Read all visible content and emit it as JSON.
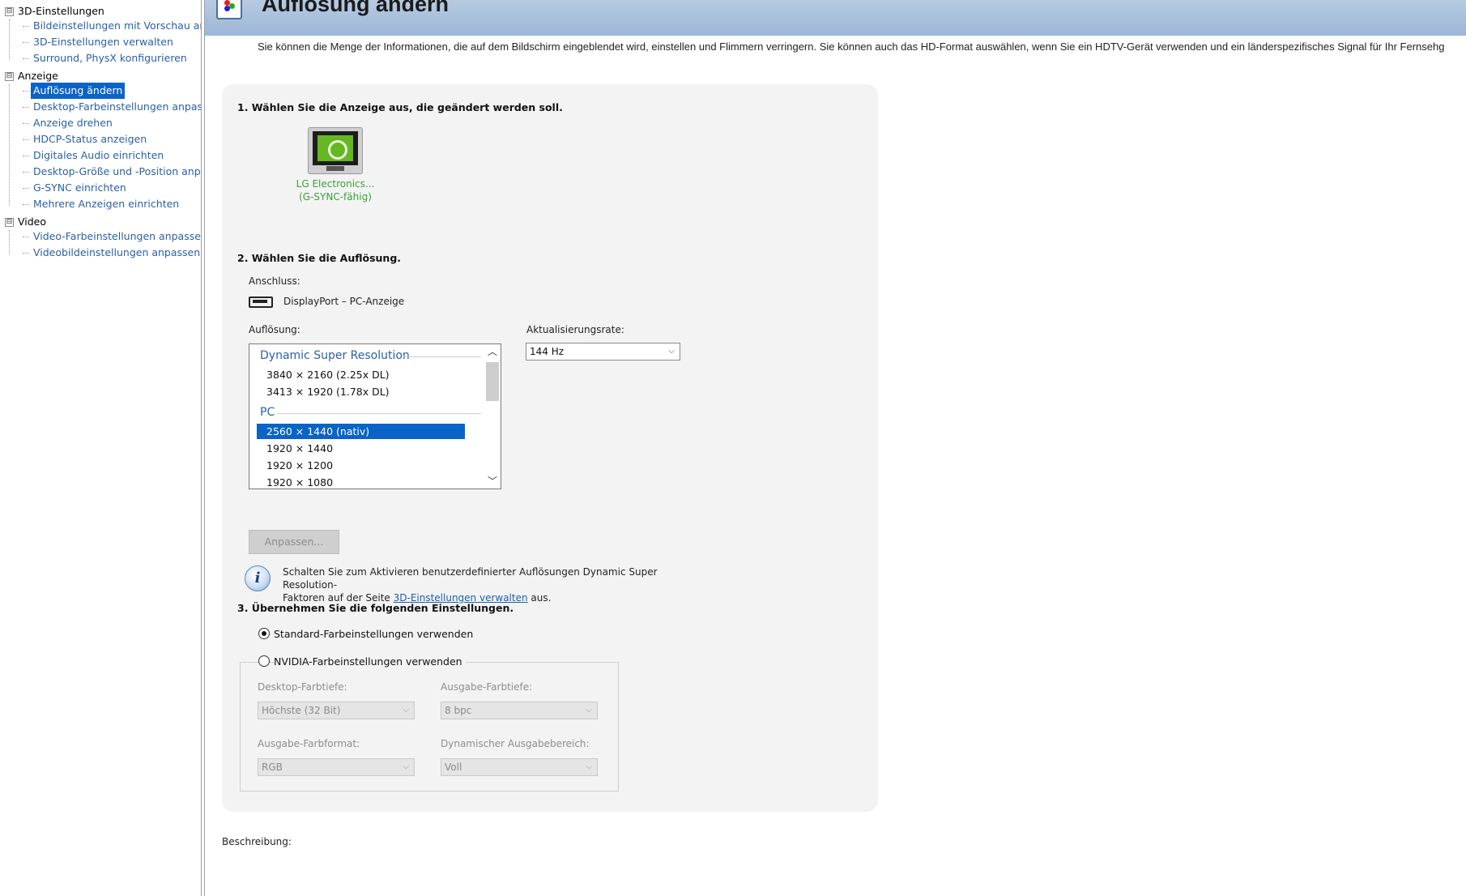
{
  "sidebar": {
    "groups": [
      {
        "label": "3D-Einstellungen",
        "items": [
          {
            "label": "Bildeinstellungen mit Vorschau anpa"
          },
          {
            "label": "3D-Einstellungen verwalten"
          },
          {
            "label": "Surround, PhysX konfigurieren"
          }
        ]
      },
      {
        "label": "Anzeige",
        "items": [
          {
            "label": "Auflösung ändern"
          },
          {
            "label": "Desktop-Farbeinstellungen anpasser"
          },
          {
            "label": "Anzeige drehen"
          },
          {
            "label": "HDCP-Status anzeigen"
          },
          {
            "label": "Digitales Audio einrichten"
          },
          {
            "label": "Desktop-Größe und -Position anpass"
          },
          {
            "label": "G-SYNC einrichten"
          },
          {
            "label": "Mehrere Anzeigen einrichten"
          }
        ]
      },
      {
        "label": "Video",
        "items": [
          {
            "label": "Video-Farbeinstellungen anpassen"
          },
          {
            "label": "Videobildeinstellungen anpassen"
          }
        ]
      }
    ],
    "expander_symbol": "⊟",
    "selected_item": "Auflösung ändern"
  },
  "header": {
    "title": "Auflösung ändern",
    "icon": "display-color-icon"
  },
  "intro": "Sie können die Menge der Informationen, die auf dem Bildschirm eingeblendet wird, einstellen und Flimmern verringern. Sie können auch das HD-Format auswählen, wenn Sie ein HDTV-Gerät verwenden und ein länderspezifisches Signal für Ihr Fernsehg",
  "step1": {
    "title": "1. Wählen Sie die Anzeige aus, die geändert werden soll.",
    "display": {
      "name": "LG Electronics...",
      "status": "(G-SYNC-fähig)"
    }
  },
  "step2": {
    "title": "2. Wählen Sie die Auflösung.",
    "connection_label": "Anschluss:",
    "connection_value": "DisplayPort – PC-Anzeige",
    "resolution_label": "Auflösung:",
    "refresh_label": "Aktualisierungsrate:",
    "refresh_value": "144 Hz",
    "resolution_groups": [
      {
        "label": "Dynamic Super Resolution",
        "items": [
          "3840 × 2160 (2.25x DL)",
          "3413 × 1920 (1.78x DL)"
        ]
      },
      {
        "label": "PC",
        "items": [
          "2560 × 1440 (nativ)",
          "1920 × 1440",
          "1920 × 1200",
          "1920 × 1080"
        ]
      }
    ],
    "selected_resolution": "2560 × 1440 (nativ)",
    "customize_button": "Anpassen...",
    "info_text_1": "Schalten Sie zum Aktivieren benutzerdefinierter Auflösungen Dynamic Super Resolution-",
    "info_text_2": "Faktoren auf der Seite ",
    "info_link": "3D-Einstellungen verwalten",
    "info_text_3": " aus."
  },
  "step3": {
    "title": "3. Übernehmen Sie die folgenden Einstellungen.",
    "option_default": "Standard-Farbeinstellungen verwenden",
    "option_nvidia": "NVIDIA-Farbeinstellungen verwenden",
    "selected_option": "default",
    "desktop_depth_label": "Desktop-Farbtiefe:",
    "desktop_depth_value": "Höchste (32 Bit)",
    "output_depth_label": "Ausgabe-Farbtiefe:",
    "output_depth_value": "8 bpc",
    "output_format_label": "Ausgabe-Farbformat:",
    "output_format_value": "RGB",
    "dynamic_range_label": "Dynamischer Ausgabebereich:",
    "dynamic_range_value": "Voll"
  },
  "description_label": "Beschreibung:",
  "colors": {
    "accent": "#0a64c8",
    "link": "#2a5fa8",
    "nvidia_green": "#66b822",
    "display_label": "#3aa13a",
    "banner": "#9cb6d6"
  }
}
